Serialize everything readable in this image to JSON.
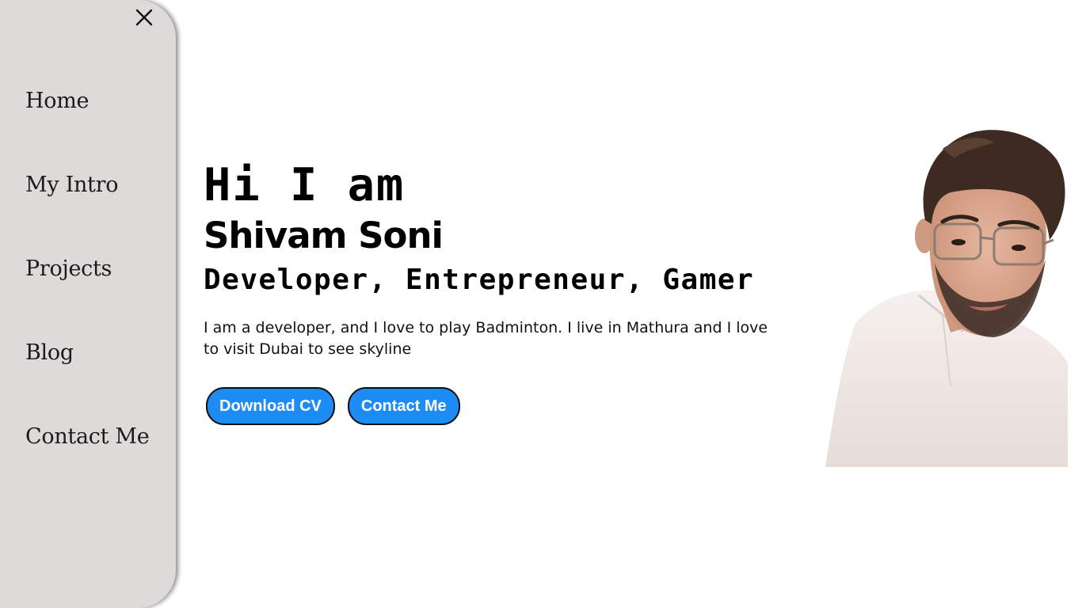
{
  "sidebar": {
    "close_icon": "close-icon",
    "items": [
      {
        "label": "Home"
      },
      {
        "label": "My Intro"
      },
      {
        "label": "Projects"
      },
      {
        "label": "Blog"
      },
      {
        "label": "Contact Me"
      }
    ]
  },
  "hero": {
    "greeting": "Hi I am",
    "name": "Shivam Soni",
    "roles": "Developer, Entrepreneur, Gamer",
    "bio": "I am a developer, and I love to play Badminton. I live in Mathura and I love to visit Dubai to see skyline",
    "buttons": {
      "download_cv": "Download CV",
      "contact_me": "Contact Me"
    }
  },
  "colors": {
    "sidebar_bg": "#dedad9",
    "button_bg": "#1e8cf5",
    "button_text": "#ffffff"
  }
}
